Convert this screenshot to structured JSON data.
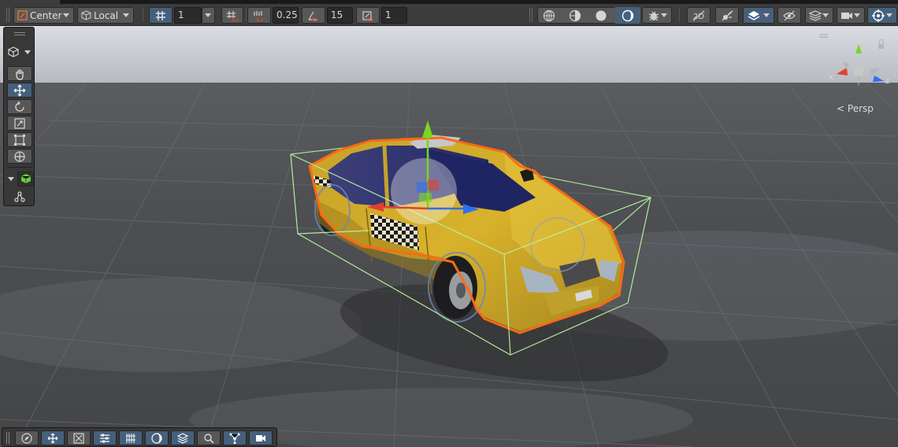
{
  "toolbar": {
    "pivot_mode": "Center",
    "pivot_rotation": "Local",
    "grid_size_value": "1",
    "snap_move_value": "0.25",
    "snap_rotate_value": "15",
    "snap_scale_value": "1"
  },
  "scene": {
    "projection_label": "Persp",
    "axes": {
      "x": "x",
      "y": "y",
      "z": "z"
    }
  },
  "colors": {
    "toolbar_bg": "#3c3c3c",
    "button_bg": "#585858",
    "button_active": "#46607c",
    "selection_outline": "#ff6a13",
    "bounds_box": "#b9f59e",
    "axis_x": "#e0412f",
    "axis_y": "#7ad51f",
    "axis_z": "#2f6ff0",
    "taxi_yellow": "#d8b22a"
  },
  "icons": {
    "top_left": [
      "pivot-center-icon",
      "pivot-local-icon",
      "grid-icon",
      "snap-increment-icon",
      "snap-rotate-icon",
      "snap-angle-icon",
      "snap-scale-icon"
    ],
    "top_right": [
      "wireframe-sphere-icon",
      "shaded-wireframe-icon",
      "shaded-sphere-icon",
      "lighting-toggle-icon",
      "gizmo-bug-icon",
      "2d-toggle-icon",
      "lighting-off-icon",
      "layers-icon",
      "visibility-icon",
      "layer-stack-icon",
      "camera-icon",
      "gizmos-icon"
    ],
    "left_tools": [
      "view-tool-hand-icon",
      "move-tool-icon",
      "rotate-tool-icon",
      "scale-tool-icon",
      "rect-tool-icon",
      "transform-tool-icon",
      "custom-tool-cube-icon",
      "custom-tool-path-icon"
    ],
    "bottom": [
      "compass-icon",
      "move-icon",
      "scale-icon",
      "sliders-icon",
      "grid-lines-icon",
      "circle-icon",
      "layers-icon",
      "search-icon",
      "network-icon",
      "camera-icon"
    ]
  }
}
